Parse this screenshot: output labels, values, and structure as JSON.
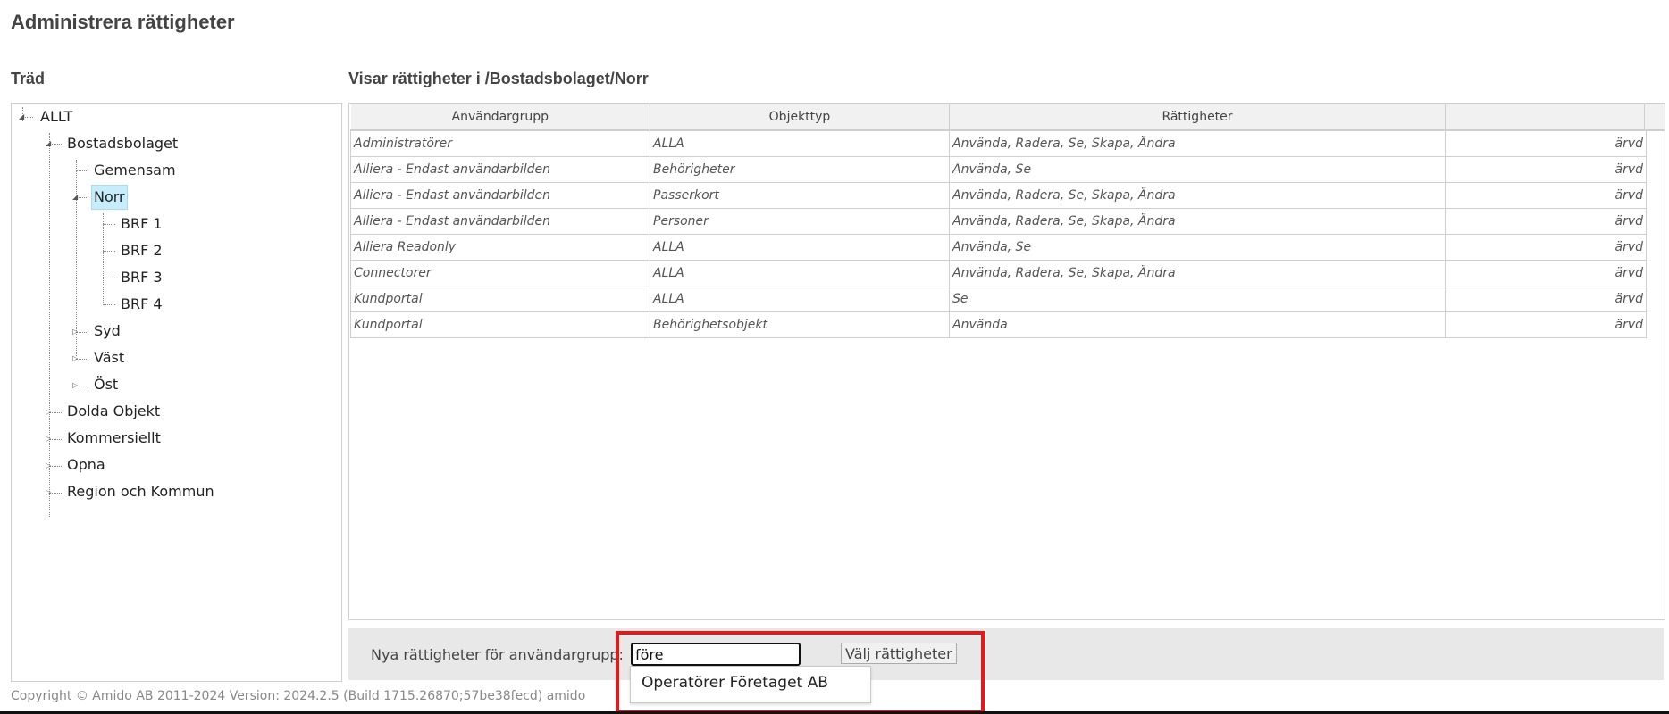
{
  "page": {
    "title": "Administrera rättigheter"
  },
  "tree": {
    "heading": "Träd",
    "nodes": {
      "allt": "ALLT",
      "bostadsbolaget": "Bostadsbolaget",
      "gemensam": "Gemensam",
      "norr": "Norr",
      "brf1": "BRF 1",
      "brf2": "BRF 2",
      "brf3": "BRF 3",
      "brf4": "BRF 4",
      "syd": "Syd",
      "vast": "Väst",
      "ost": "Öst",
      "dolda": "Dolda Objekt",
      "kommersiellt": "Kommersiellt",
      "opna": "Opna",
      "region": "Region och Kommun"
    },
    "selected": "Norr"
  },
  "grid": {
    "heading": "Visar rättigheter i /Bostadsbolaget/Norr",
    "columns": [
      "Användargrupp",
      "Objekttyp",
      "Rättigheter",
      ""
    ],
    "rows": [
      [
        "Administratörer",
        "ALLA",
        "Använda, Radera, Se, Skapa, Ändra",
        "ärvd"
      ],
      [
        "Alliera - Endast användarbilden",
        "Behörigheter",
        "Använda, Se",
        "ärvd"
      ],
      [
        "Alliera - Endast användarbilden",
        "Passerkort",
        "Använda, Radera, Se, Skapa, Ändra",
        "ärvd"
      ],
      [
        "Alliera - Endast användarbilden",
        "Personer",
        "Använda, Radera, Se, Skapa, Ändra",
        "ärvd"
      ],
      [
        "Alliera Readonly",
        "ALLA",
        "Använda, Se",
        "ärvd"
      ],
      [
        "Connectorer",
        "ALLA",
        "Använda, Radera, Se, Skapa, Ändra",
        "ärvd"
      ],
      [
        "Kundportal",
        "ALLA",
        "Se",
        "ärvd"
      ],
      [
        "Kundportal",
        "Behörighetsobjekt",
        "Använda",
        "ärvd"
      ]
    ]
  },
  "assign": {
    "label": "Nya rättigheter för användargrupp:",
    "input_value": "före",
    "button_label": "Välj rättigheter",
    "suggestions": [
      "Operatörer Företaget AB"
    ]
  },
  "footer": {
    "text": "Copyright © Amido AB 2011-2024  Version: 2024.2.5 (Build 1715.26870;57be38fecd) amido"
  },
  "colors": {
    "selected_bg": "#c7ecfb",
    "highlight_border": "#e3191b",
    "header_bg": "#f1f1f1"
  },
  "icons": {
    "expanded": "triangle-down-icon",
    "collapsed": "triangle-right-icon"
  }
}
